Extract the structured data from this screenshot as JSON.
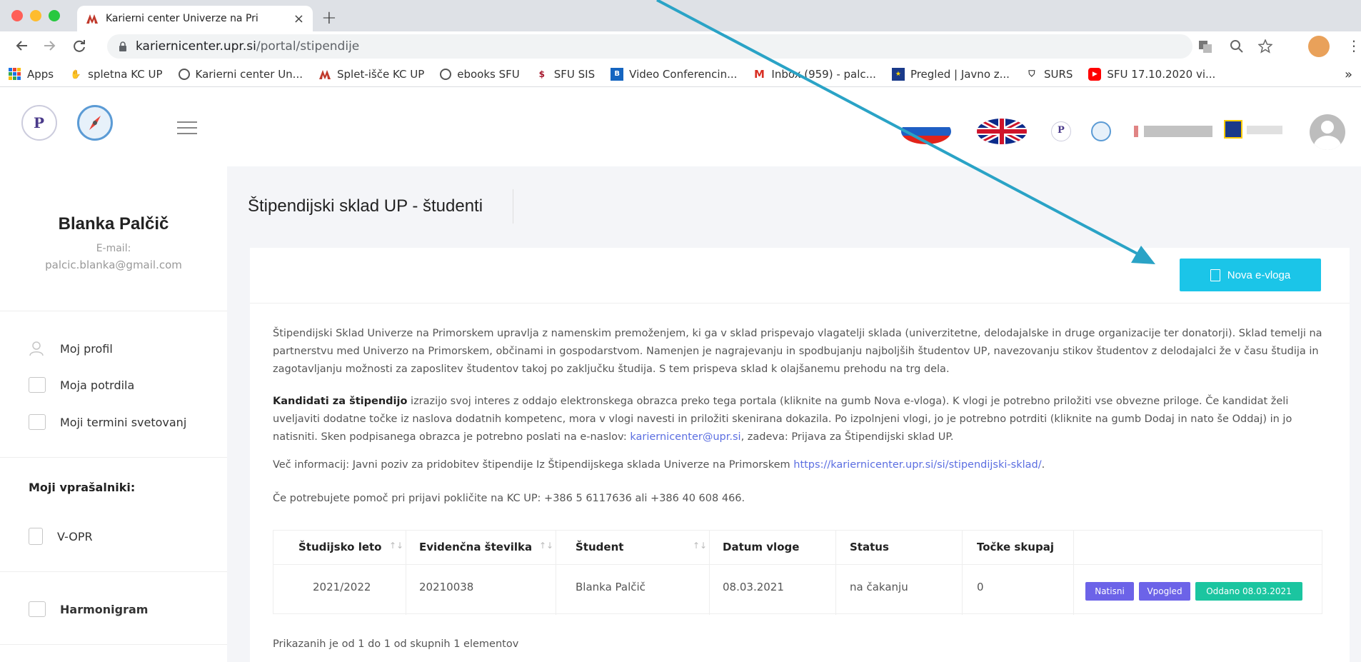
{
  "browser": {
    "tab_title": "Karierni center Univerze na Pri",
    "tab_close": "×",
    "new_tab": "+",
    "url_host": "kariernicenter.upr.si",
    "url_path": "/portal/stipendije",
    "bookmarks": [
      {
        "label": "Apps",
        "icon": "apps-icon",
        "color": "#1a73e8"
      },
      {
        "label": "spletna KC UP",
        "icon": "hand-icon",
        "color": "#f28b30"
      },
      {
        "label": "Karierni center Un...",
        "icon": "globe-icon",
        "color": "#555555"
      },
      {
        "label": "Splet-išče KC UP",
        "icon": "kc-logo-icon",
        "color": "#c0392b"
      },
      {
        "label": "ebooks SFU",
        "icon": "globe-icon",
        "color": "#555555"
      },
      {
        "label": "SFU SIS",
        "icon": "sfu-icon",
        "color": "#a6192e"
      },
      {
        "label": "Video Conferencin...",
        "icon": "video-icon",
        "color": "#1565c0"
      },
      {
        "label": "Inbox (959) - palc...",
        "icon": "gmail-icon",
        "color": "#d93025"
      },
      {
        "label": "Pregled | Javno z...",
        "icon": "eu-flag-icon",
        "color": "#1a3a8a"
      },
      {
        "label": "SURS",
        "icon": "surs-icon",
        "color": "#333333"
      },
      {
        "label": "SFU 17.10.2020 vi...",
        "icon": "youtube-icon",
        "color": "#ff0000"
      }
    ],
    "bookmarks_more": "»"
  },
  "sidebar": {
    "name": "Blanka Palčič",
    "email_label": "E-mail:",
    "email": "palcic.blanka@gmail.com",
    "items": [
      {
        "label": "Moj profil"
      },
      {
        "label": "Moja potrdila"
      },
      {
        "label": "Moji termini svetovanj"
      }
    ],
    "questionnaires_heading": "Moji vprašalniki:",
    "questionnaire_item": "V-OPR",
    "harmonogram": "Harmonigram"
  },
  "main": {
    "title": "Štipendijski sklad UP - študenti",
    "new_button": "Nova e-vloga",
    "para1": "Štipendijski Sklad Univerze na Primorskem upravlja z namenskim premoženjem, ki ga v sklad prispevajo vlagatelji sklada (univerzitetne, delodajalske in druge organizacije ter donatorji). Sklad temelji na partnerstvu med Univerzo na Primorskem, občinami in gospodarstvom. Namenjen je nagrajevanju in spodbujanju najboljših študentov UP, navezovanju stikov študentov z delodajalci že v času študija in zagotavljanju možnosti za zaposlitev študentov takoj po zaključku študija. S tem prispeva sklad k olajšanemu prehodu na trg dela.",
    "para2_bold": "Kandidati za štipendijo",
    "para2_a": " izrazijo svoj interes z oddajo elektronskega obrazca preko tega portala (kliknite na gumb Nova e-vloga). K vlogi je potrebno priložiti vse obvezne priloge. Če kandidat želi uveljaviti dodatne točke iz naslova dodatnih kompetenc, mora v vlogi navesti in priložiti skenirana dokazila. Po izpolnjeni vlogi, jo je potrebno potrditi (kliknite na gumb Dodaj in nato še Oddaj) in jo natisniti. Sken podpisanega obrazca je potrebno poslati na e-naslov: ",
    "para2_email": "kariernicenter@upr.si",
    "para2_b": ", zadeva: Prijava za Štipendijski sklad UP.",
    "para3_a": "Več informacij: Javni poziv za pridobitev štipendije Iz Štipendijskega sklada Univerze na Primorskem ",
    "para3_link": "https://kariernicenter.upr.si/si/stipendijski-sklad/",
    "para3_b": ".",
    "para4": "Če potrebujete pomoč pri prijavi pokličite na KC UP: +386 5 6117636 ali +386 40 608 466.",
    "table": {
      "headers": [
        "Študijsko leto",
        "Evidenčna številka",
        "Študent",
        "Datum vloge",
        "Status",
        "Točke skupaj"
      ],
      "sort_glyph": "↑↓",
      "row": [
        "2021/2022",
        "20210038",
        "Blanka Palčič",
        "08.03.2021",
        "na čakanju",
        "0"
      ],
      "badges": [
        {
          "label": "Natisni",
          "color": "#6c63e8"
        },
        {
          "label": "Vpogled",
          "color": "#6c63e8"
        },
        {
          "label": "Oddano 08.03.2021",
          "color": "#1bc5a0"
        }
      ]
    },
    "footer": "Prikazanih je od 1 do 1 od skupnih 1 elementov"
  },
  "colors": {
    "accent": "#1bc5e8",
    "arrow": "#2aa3c6"
  }
}
